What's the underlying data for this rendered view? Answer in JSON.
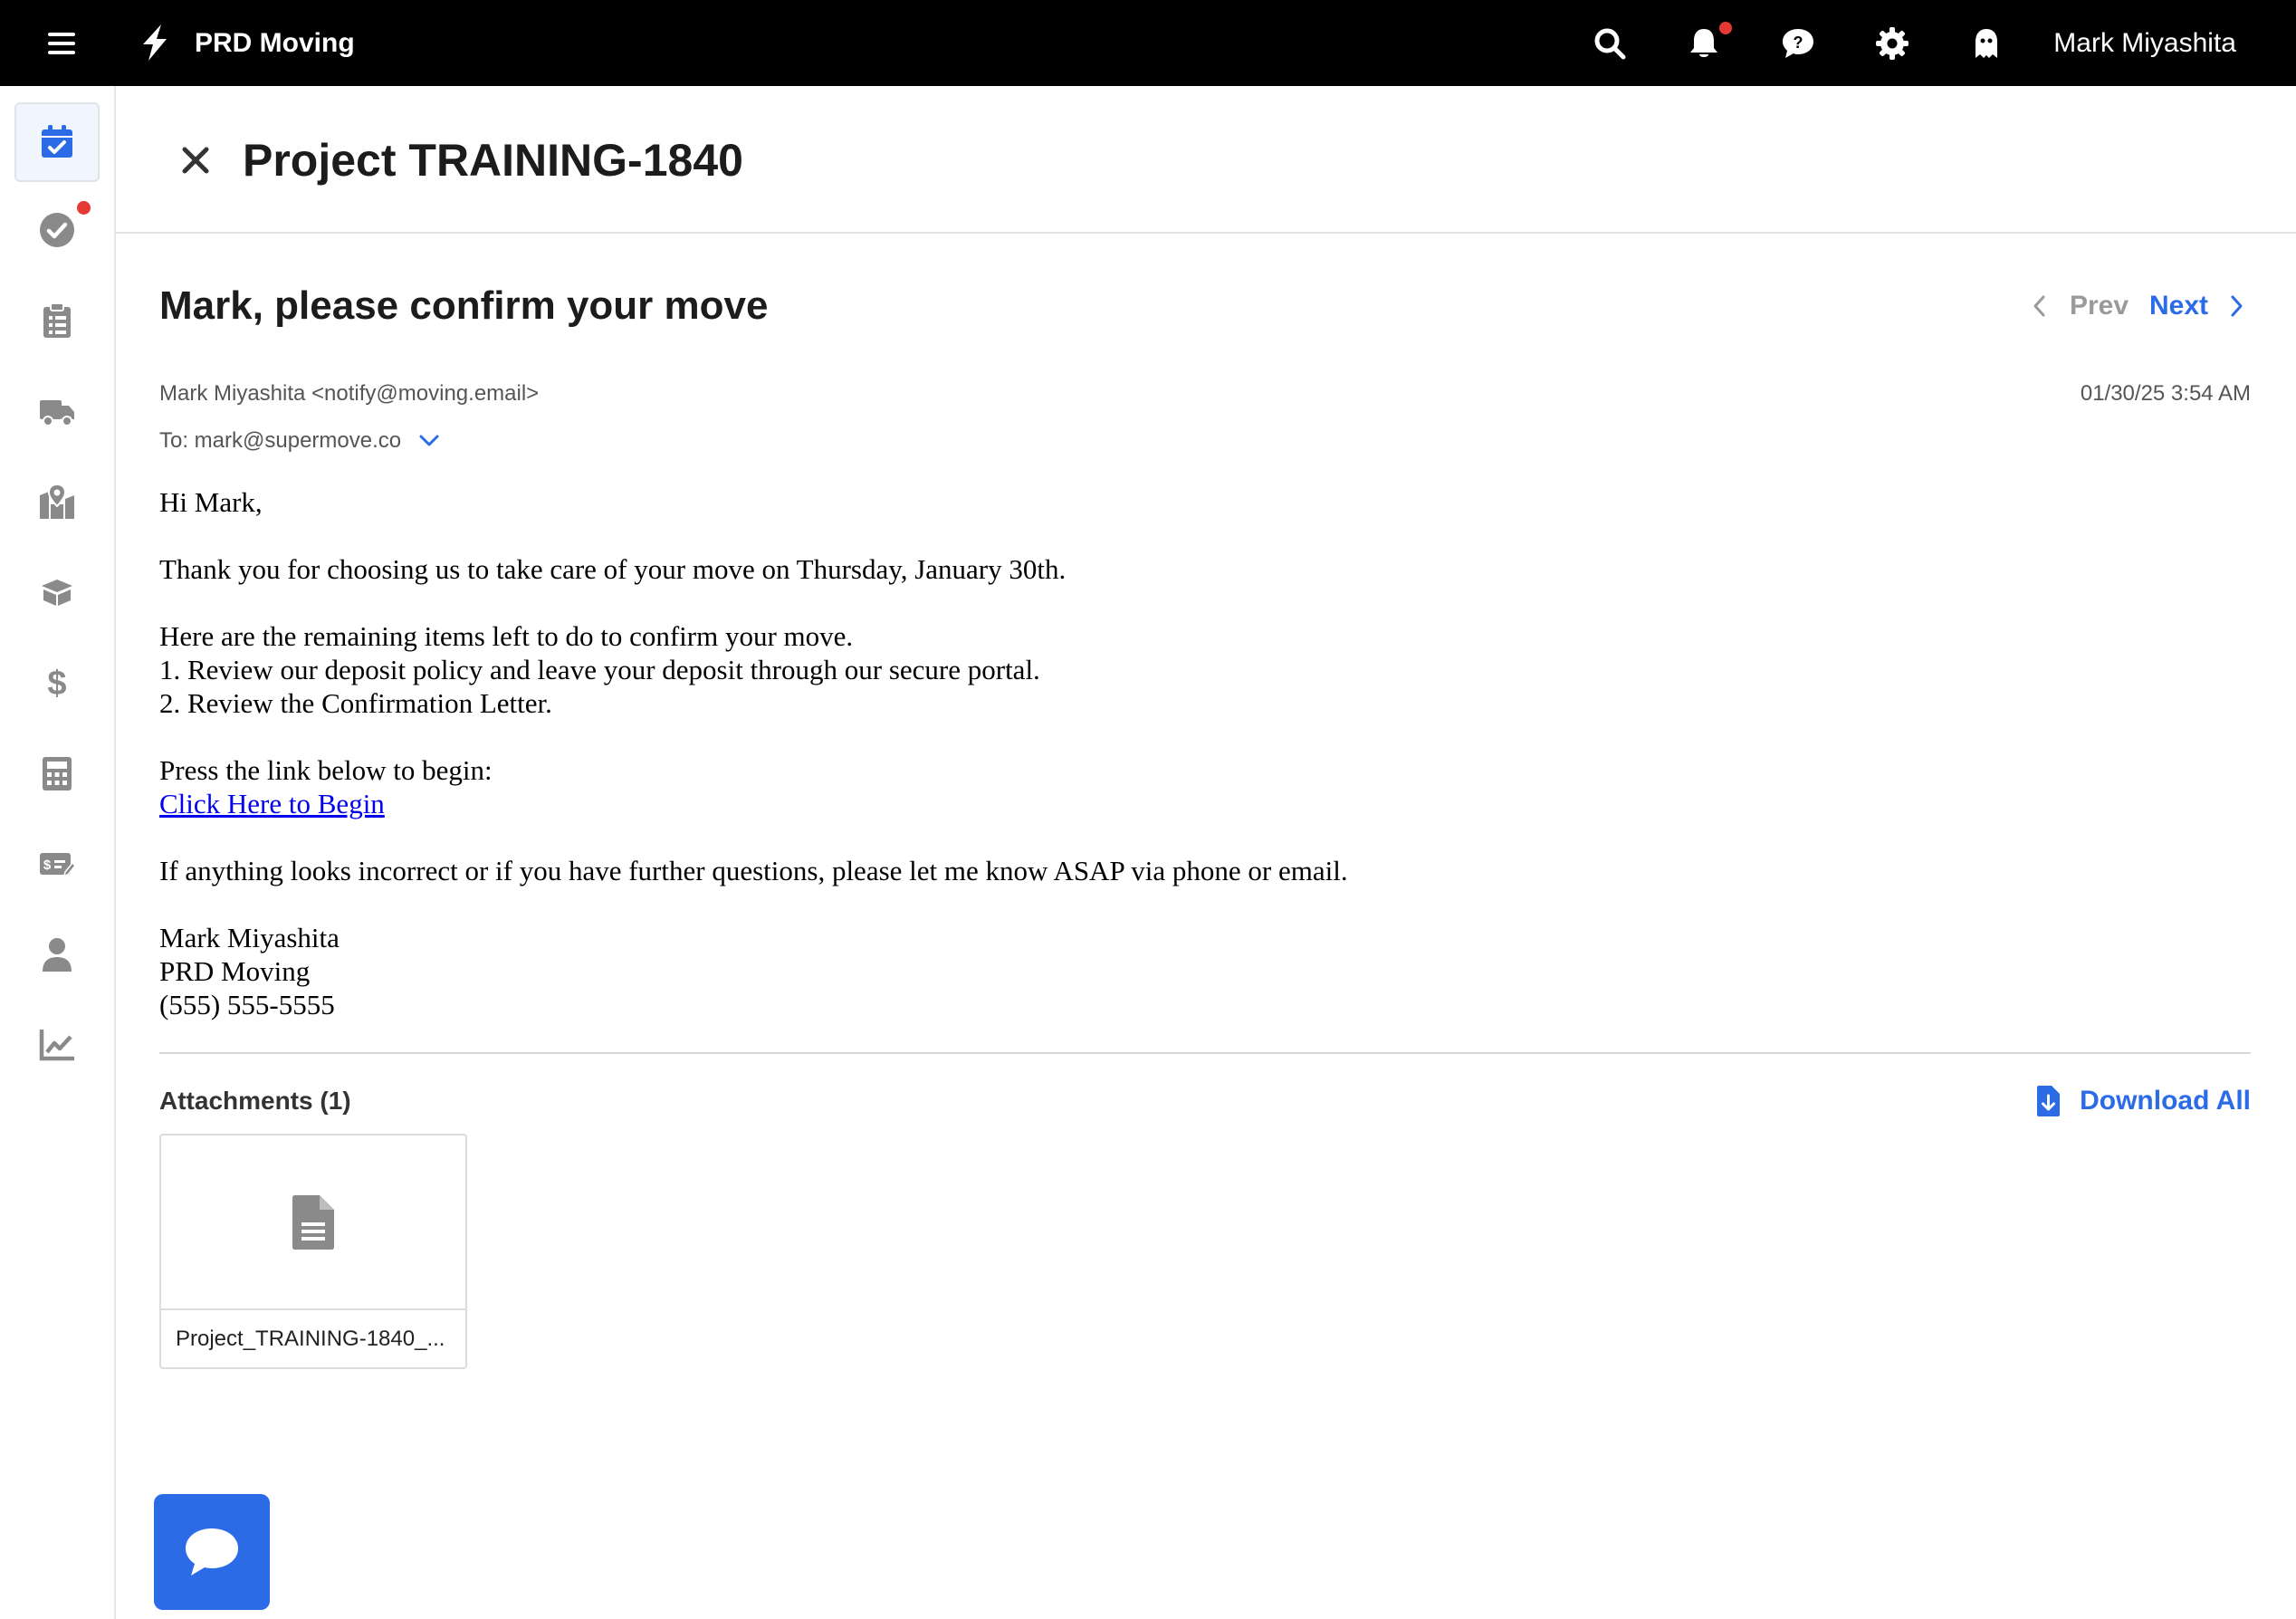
{
  "topbar": {
    "brand": "PRD Moving",
    "user_name": "Mark Miyashita",
    "icons": [
      "menu-icon",
      "lightning-logo-icon",
      "search-icon",
      "bell-icon",
      "chat-question-icon",
      "gear-icon",
      "ghost-icon"
    ]
  },
  "sidenav": {
    "items": [
      "calendar-check-icon",
      "check-circle-icon",
      "clipboard-list-icon",
      "truck-icon",
      "map-pin-icon",
      "box-icon",
      "dollar-icon",
      "calculator-icon",
      "invoice-edit-icon",
      "user-icon",
      "chart-line-icon"
    ],
    "active": "calendar-check-icon"
  },
  "header": {
    "title": "Project TRAINING-1840"
  },
  "email": {
    "subject": "Mark, please confirm your move",
    "prev_label": "Prev",
    "next_label": "Next",
    "from": "Mark Miyashita <notify@moving.email>",
    "date": "01/30/25 3:54 AM",
    "to": "To: mark@supermove.co",
    "body": {
      "greeting": "Hi Mark,",
      "thanks": "Thank you for choosing us to take care of your move on Thursday, January 30th.",
      "intro": "Here are the remaining items left to do to confirm your move.",
      "item1": "1. Review our deposit policy and leave your deposit through our secure portal.",
      "item2": "2. Review the Confirmation Letter.",
      "press": "Press the link below to begin:",
      "link": "Click Here to Begin",
      "questions": "If anything looks incorrect or if you have further questions, please let me know ASAP via phone or email.",
      "sig_name": "Mark Miyashita",
      "sig_company": "PRD Moving",
      "sig_phone": "(555) 555-5555"
    }
  },
  "attachments": {
    "title": "Attachments (1)",
    "download_all": "Download All",
    "files": [
      {
        "name": "Project_TRAINING-1840_..."
      }
    ]
  },
  "colors": {
    "accent": "#2c6be6",
    "topbar": "#000000",
    "notification_dot": "#e53935",
    "icon_gray": "#8a8a8a"
  }
}
